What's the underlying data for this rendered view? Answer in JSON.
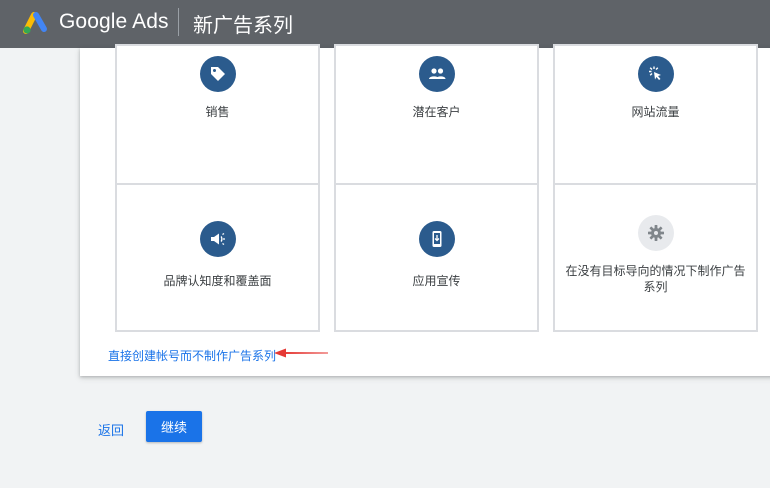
{
  "header": {
    "brand_name": "Google Ads",
    "page_title": "新广告系列",
    "background_color": "#5f6368"
  },
  "goals": [
    {
      "label": "销售",
      "icon": "tag-icon"
    },
    {
      "label": "潜在客户",
      "icon": "people-icon"
    },
    {
      "label": "网站流量",
      "icon": "cursor-click-icon"
    },
    {
      "label": "品牌认知度和覆盖面",
      "icon": "megaphone-icon"
    },
    {
      "label": "应用宣传",
      "icon": "phone-download-icon"
    },
    {
      "label": "在没有目标导向的情况下制作广告系列",
      "icon": "gear-icon"
    }
  ],
  "skip_link": "直接创建帐号而不制作广告系列",
  "footer": {
    "back_label": "返回",
    "continue_label": "继续"
  },
  "colors": {
    "accent": "#1a73e8",
    "icon_blue": "#2b5b8d",
    "annotation_red": "#e53935"
  }
}
